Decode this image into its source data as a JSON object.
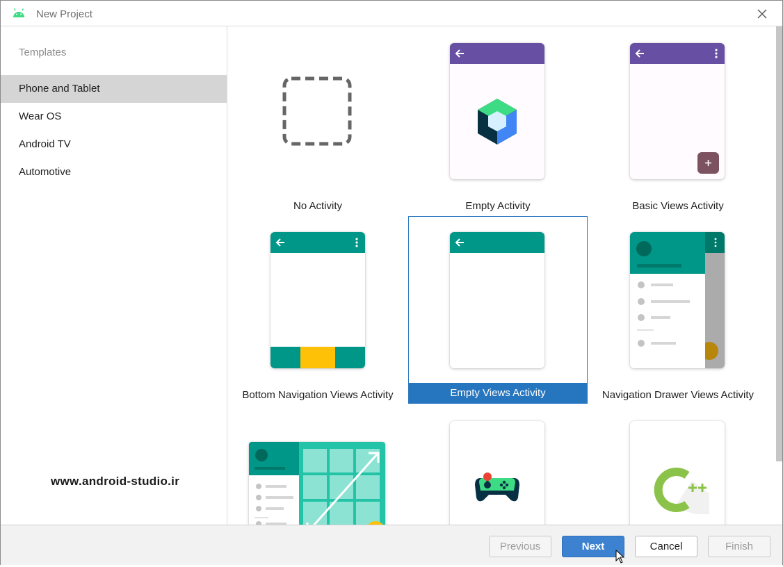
{
  "window": {
    "title": "New Project",
    "title_icon": "android-icon",
    "close_icon": "close-icon"
  },
  "sidebar": {
    "heading": "Templates",
    "items": [
      {
        "label": "Phone and Tablet",
        "selected": true
      },
      {
        "label": "Wear OS",
        "selected": false
      },
      {
        "label": "Android TV",
        "selected": false
      },
      {
        "label": "Automotive",
        "selected": false
      }
    ]
  },
  "watermark": "www.android-studio.ir",
  "templates": [
    {
      "label": "No Activity",
      "icon": "dashed-square-icon"
    },
    {
      "label": "Empty Activity",
      "icon": "jetpack-compose-icon"
    },
    {
      "label": "Basic Views Activity",
      "icon": "fab-icon"
    },
    {
      "label": "Bottom Navigation Views Activity",
      "icon": "bottom-nav-icon"
    },
    {
      "label": "Empty Views Activity",
      "icon": "empty-phone-icon",
      "selected": true
    },
    {
      "label": "Navigation Drawer Views Activity",
      "icon": "nav-drawer-icon"
    },
    {
      "label": "",
      "icon": "responsive-grid-icon"
    },
    {
      "label": "",
      "icon": "game-controller-icon"
    },
    {
      "label": "",
      "icon": "cpp-icon"
    }
  ],
  "colors": {
    "purple": "#6750a4",
    "teal": "#009688",
    "yellow": "#ffc107",
    "selection": "#2675bf",
    "primary_button": "#3d82d1"
  },
  "footer": {
    "previous": "Previous",
    "next": "Next",
    "cancel": "Cancel",
    "finish": "Finish"
  }
}
